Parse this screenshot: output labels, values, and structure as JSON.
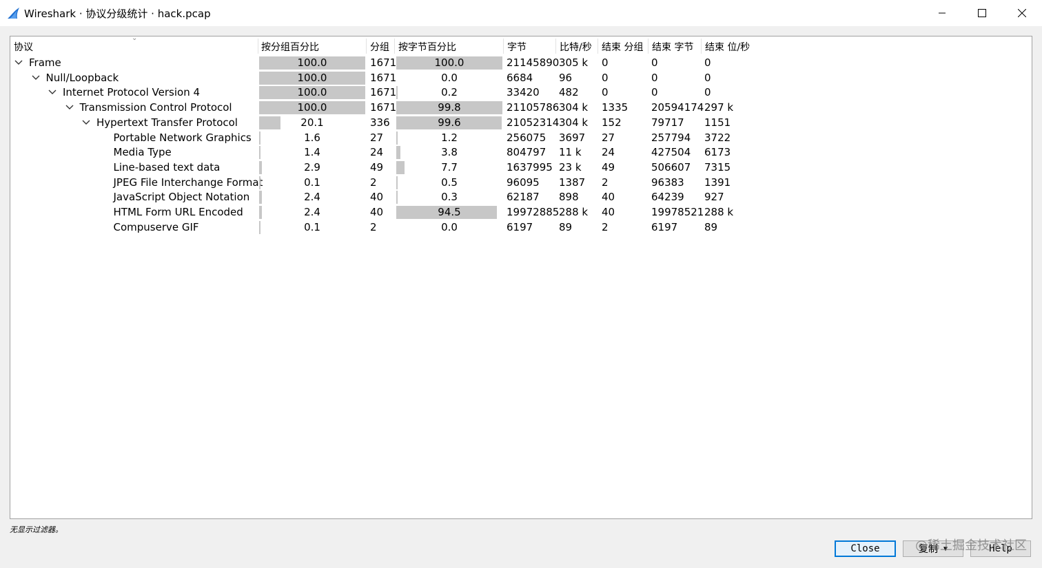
{
  "window": {
    "title": "Wireshark · 协议分级统计 · hack.pcap",
    "minimize_icon": "minimize-icon",
    "maximize_icon": "maximize-icon",
    "close_icon": "close-icon"
  },
  "table": {
    "headers": {
      "protocol": "协议",
      "pct_packets": "按分组百分比",
      "packets": "分组",
      "pct_bytes": "按字节百分比",
      "bytes": "字节",
      "bits_s": "比特/秒",
      "end_packets": "结束 分组",
      "end_bytes": "结束 字节",
      "end_bits_s": "结束 位/秒"
    },
    "rows": [
      {
        "protocol": "Frame",
        "level": 0,
        "expanded": true,
        "pct_packets": "100.0",
        "pct_packets_value": 100.0,
        "packets": "1671",
        "pct_bytes": "100.0",
        "pct_bytes_value": 100.0,
        "bytes": "21145890",
        "bits_s": "305 k",
        "end_packets": "0",
        "end_bytes": "0",
        "end_bits_s": "0"
      },
      {
        "protocol": "Null/Loopback",
        "level": 1,
        "expanded": true,
        "pct_packets": "100.0",
        "pct_packets_value": 100.0,
        "packets": "1671",
        "pct_bytes": "0.0",
        "pct_bytes_value": 0.0,
        "bytes": "6684",
        "bits_s": "96",
        "end_packets": "0",
        "end_bytes": "0",
        "end_bits_s": "0"
      },
      {
        "protocol": "Internet Protocol Version 4",
        "level": 2,
        "expanded": true,
        "pct_packets": "100.0",
        "pct_packets_value": 100.0,
        "packets": "1671",
        "pct_bytes": "0.2",
        "pct_bytes_value": 0.2,
        "bytes": "33420",
        "bits_s": "482",
        "end_packets": "0",
        "end_bytes": "0",
        "end_bits_s": "0"
      },
      {
        "protocol": "Transmission Control Protocol",
        "level": 3,
        "expanded": true,
        "pct_packets": "100.0",
        "pct_packets_value": 100.0,
        "packets": "1671",
        "pct_bytes": "99.8",
        "pct_bytes_value": 99.8,
        "bytes": "21105786",
        "bits_s": "304 k",
        "end_packets": "1335",
        "end_bytes": "20594174",
        "end_bits_s": "297 k"
      },
      {
        "protocol": "Hypertext Transfer Protocol",
        "level": 4,
        "expanded": true,
        "pct_packets": "20.1",
        "pct_packets_value": 20.1,
        "packets": "336",
        "pct_bytes": "99.6",
        "pct_bytes_value": 99.6,
        "bytes": "21052314",
        "bits_s": "304 k",
        "end_packets": "152",
        "end_bytes": "79717",
        "end_bits_s": "1151"
      },
      {
        "protocol": "Portable Network Graphics",
        "level": 5,
        "expanded": false,
        "pct_packets": "1.6",
        "pct_packets_value": 1.6,
        "packets": "27",
        "pct_bytes": "1.2",
        "pct_bytes_value": 1.2,
        "bytes": "256075",
        "bits_s": "3697",
        "end_packets": "27",
        "end_bytes": "257794",
        "end_bits_s": "3722"
      },
      {
        "protocol": "Media Type",
        "level": 5,
        "expanded": false,
        "pct_packets": "1.4",
        "pct_packets_value": 1.4,
        "packets": "24",
        "pct_bytes": "3.8",
        "pct_bytes_value": 3.8,
        "bytes": "804797",
        "bits_s": "11 k",
        "end_packets": "24",
        "end_bytes": "427504",
        "end_bits_s": "6173"
      },
      {
        "protocol": "Line-based text data",
        "level": 5,
        "expanded": false,
        "pct_packets": "2.9",
        "pct_packets_value": 2.9,
        "packets": "49",
        "pct_bytes": "7.7",
        "pct_bytes_value": 7.7,
        "bytes": "1637995",
        "bits_s": "23 k",
        "end_packets": "49",
        "end_bytes": "506607",
        "end_bits_s": "7315"
      },
      {
        "protocol": "JPEG File Interchange Format",
        "level": 5,
        "expanded": false,
        "pct_packets": "0.1",
        "pct_packets_value": 0.1,
        "packets": "2",
        "pct_bytes": "0.5",
        "pct_bytes_value": 0.5,
        "bytes": "96095",
        "bits_s": "1387",
        "end_packets": "2",
        "end_bytes": "96383",
        "end_bits_s": "1391"
      },
      {
        "protocol": "JavaScript Object Notation",
        "level": 5,
        "expanded": false,
        "pct_packets": "2.4",
        "pct_packets_value": 2.4,
        "packets": "40",
        "pct_bytes": "0.3",
        "pct_bytes_value": 0.3,
        "bytes": "62187",
        "bits_s": "898",
        "end_packets": "40",
        "end_bytes": "64239",
        "end_bits_s": "927"
      },
      {
        "protocol": "HTML Form URL Encoded",
        "level": 5,
        "expanded": false,
        "pct_packets": "2.4",
        "pct_packets_value": 2.4,
        "packets": "40",
        "pct_bytes": "94.5",
        "pct_bytes_value": 94.5,
        "bytes": "19972885",
        "bits_s": "288 k",
        "end_packets": "40",
        "end_bytes": "19978521",
        "end_bits_s": "288 k"
      },
      {
        "protocol": "Compuserve GIF",
        "level": 5,
        "expanded": false,
        "pct_packets": "0.1",
        "pct_packets_value": 0.1,
        "packets": "2",
        "pct_bytes": "0.0",
        "pct_bytes_value": 0.0,
        "bytes": "6197",
        "bits_s": "89",
        "end_packets": "2",
        "end_bytes": "6197",
        "end_bits_s": "89"
      }
    ]
  },
  "status": {
    "filter_text": "无显示过滤器。"
  },
  "buttons": {
    "close_label": "Close",
    "copy_label": "复制",
    "help_label": "Help"
  },
  "watermark": "@稀土掘金技术社区",
  "colors": {
    "bar": "#c7c7c7",
    "default_button_border": "#0078d7",
    "shark_fin": "#1e6fd1"
  }
}
